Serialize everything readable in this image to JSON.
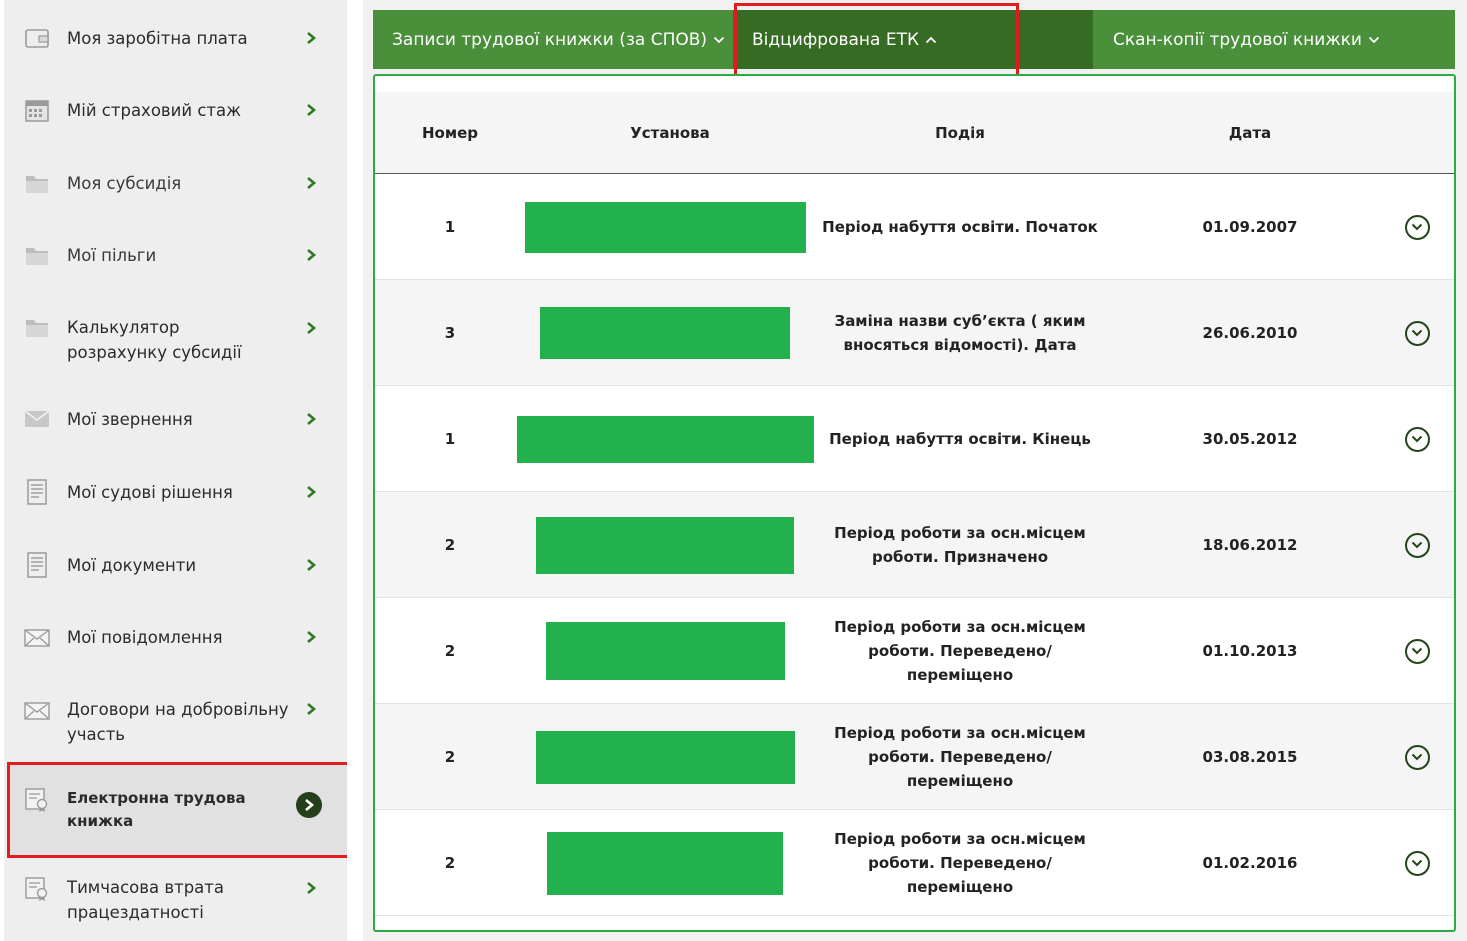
{
  "sidebar": {
    "items": [
      {
        "label": "Моя заробітна плата",
        "icon": "wallet-icon"
      },
      {
        "label": "Мій страховий стаж",
        "icon": "calendar-icon"
      },
      {
        "label": "Моя субсидія",
        "icon": "folder-icon"
      },
      {
        "label": "Мої пільги",
        "icon": "folder-icon"
      },
      {
        "label": "Калькулятор розрахунку субсидії",
        "icon": "folder-icon"
      },
      {
        "label": "Мої звернення",
        "icon": "envelope-icon"
      },
      {
        "label": "Мої судові рішення",
        "icon": "document-icon"
      },
      {
        "label": "Мої документи",
        "icon": "document-icon"
      },
      {
        "label": "Мої повідомлення",
        "icon": "envelope-icon"
      },
      {
        "label": "Договори на добровільну участь",
        "icon": "envelope-icon"
      },
      {
        "label": "Електронна трудова книжка",
        "icon": "certificate-icon",
        "active": true
      },
      {
        "label": "Тимчасова втрата працездатності",
        "icon": "certificate-icon"
      }
    ]
  },
  "tabs": [
    {
      "label": "Записи трудової книжки (за СПОВ)",
      "state": "collapsed"
    },
    {
      "label": "Відцифрована ЕТК",
      "state": "expanded",
      "active": true
    },
    {
      "label": "Скан-копії трудової книжки",
      "state": "collapsed"
    }
  ],
  "table": {
    "headers": {
      "number": "Номер",
      "org": "Установа",
      "event": "Подія",
      "date": "Дата"
    },
    "rows": [
      {
        "number": "1",
        "org": "",
        "event": "Період набуття освіти. Початок",
        "date": "01.09.2007"
      },
      {
        "number": "3",
        "org": "",
        "event": "Заміна назви суб’єкта ( яким вносяться відомості). Дата",
        "date": "26.06.2010"
      },
      {
        "number": "1",
        "org": "",
        "event": "Період набуття освіти. Кінець",
        "date": "30.05.2012"
      },
      {
        "number": "2",
        "org": "",
        "event": "Період роботи за осн.місцем роботи. Призначено",
        "date": "18.06.2012"
      },
      {
        "number": "2",
        "org": "",
        "event": "Період роботи за осн.місцем роботи. Переведено/ переміщено",
        "date": "01.10.2013"
      },
      {
        "number": "2",
        "org": "",
        "event": "Період роботи за осн.місцем роботи. Переведено/ переміщено",
        "date": "03.08.2015"
      },
      {
        "number": "2",
        "org": "",
        "event": "Період роботи за осн.місцем роботи. Переведено/ переміщено",
        "date": "01.02.2016"
      }
    ]
  },
  "colors": {
    "tab_bar": "#4a8f3a",
    "tab_active": "#356b23",
    "panel_border": "#2eaa44",
    "redaction": "#22b14c",
    "highlight_frame": "#e11b22",
    "sidebar_bg": "#eeeeee",
    "arrow": "#2f7a1f"
  }
}
